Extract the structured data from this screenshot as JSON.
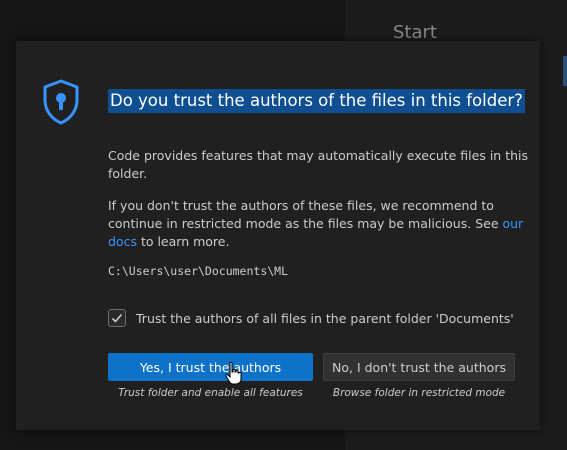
{
  "background": {
    "heading": "Start"
  },
  "dialog": {
    "title": "Do you trust the authors of the files in this folder?",
    "message1": "Code provides features that may automatically execute files in this folder.",
    "message2_before": "If you don't trust the authors of these files, we recommend to continue in restricted mode as the files may be malicious. See ",
    "message2_link": "our docs",
    "message2_after": " to learn more.",
    "folder_path": "C:\\Users\\user\\Documents\\ML",
    "checkbox": {
      "label": "Trust the authors of all files in the parent folder 'Documents'",
      "checked": true
    },
    "buttons": {
      "trust_label": "Yes, I trust the authors",
      "trust_caption": "Trust folder and enable all features",
      "distrust_label": "No, I don't trust the authors",
      "distrust_caption": "Browse folder in restricted mode"
    },
    "icon": "shield-lock-icon"
  },
  "colors": {
    "accent": "#0e72c8",
    "link": "#3794ff",
    "title_highlight": "#0f4f91"
  }
}
